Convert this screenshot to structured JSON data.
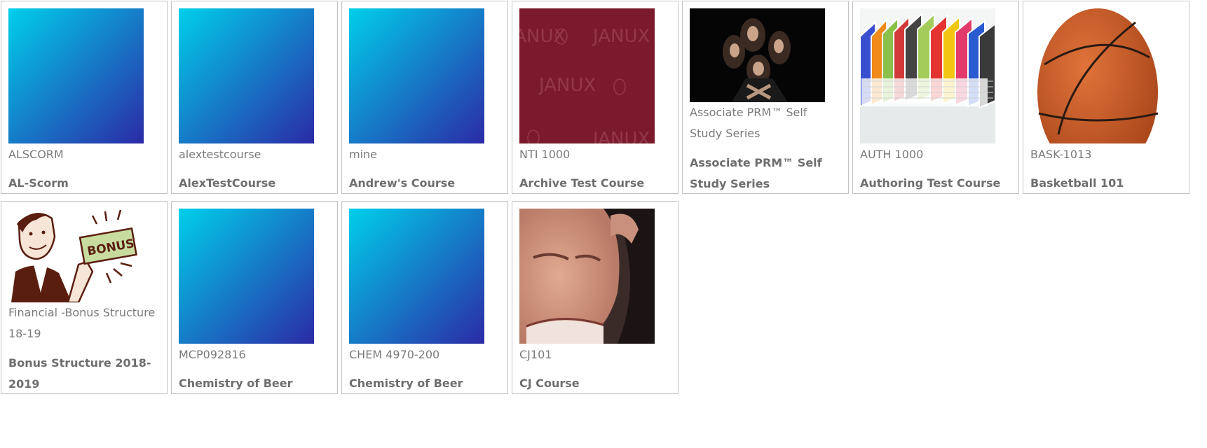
{
  "courses": [
    {
      "code": "ALSCORM",
      "title": "AL-Scorm",
      "image": "blue-gradient-thumbnail"
    },
    {
      "code": "alextestcourse",
      "title": "AlexTestCourse",
      "image": "blue-gradient-thumbnail"
    },
    {
      "code": "mine",
      "title": "Andrew's Course",
      "image": "blue-gradient-thumbnail"
    },
    {
      "code": "NTI 1000",
      "title": "Archive Test Course",
      "image": "janux-logo-pattern-thumbnail",
      "image_text": "JANUX"
    },
    {
      "code": "Associate PRM™ Self Study Series",
      "title": "Associate PRM™ Self Study Series",
      "image": "band-photo-thumbnail"
    },
    {
      "code": "AUTH 1000",
      "title": "Authoring Test Course",
      "image": "books-thumbnail"
    },
    {
      "code": "BASK-1013",
      "title": "Basketball 101",
      "image": "basketball-thumbnail"
    },
    {
      "code": "Financial -Bonus Structure 18-19",
      "title": "Bonus Structure 2018-2019",
      "image": "bonus-cartoon-thumbnail",
      "image_text": "BONUS"
    },
    {
      "code": "MCP092816",
      "title": "Chemistry of Beer",
      "image": "blue-gradient-thumbnail"
    },
    {
      "code": "CHEM 4970-200",
      "title": "Chemistry of Beer",
      "image": "blue-gradient-thumbnail"
    },
    {
      "code": "CJ101",
      "title": "CJ Course",
      "image": "face-photo-thumbnail"
    }
  ],
  "colors": {
    "gradient_start": "#00c8e8",
    "gradient_end": "#2a2aa8",
    "janux_maroon": "#7b1a2c",
    "card_border": "#c3c3c3",
    "text_gray": "#7a7a7a"
  }
}
